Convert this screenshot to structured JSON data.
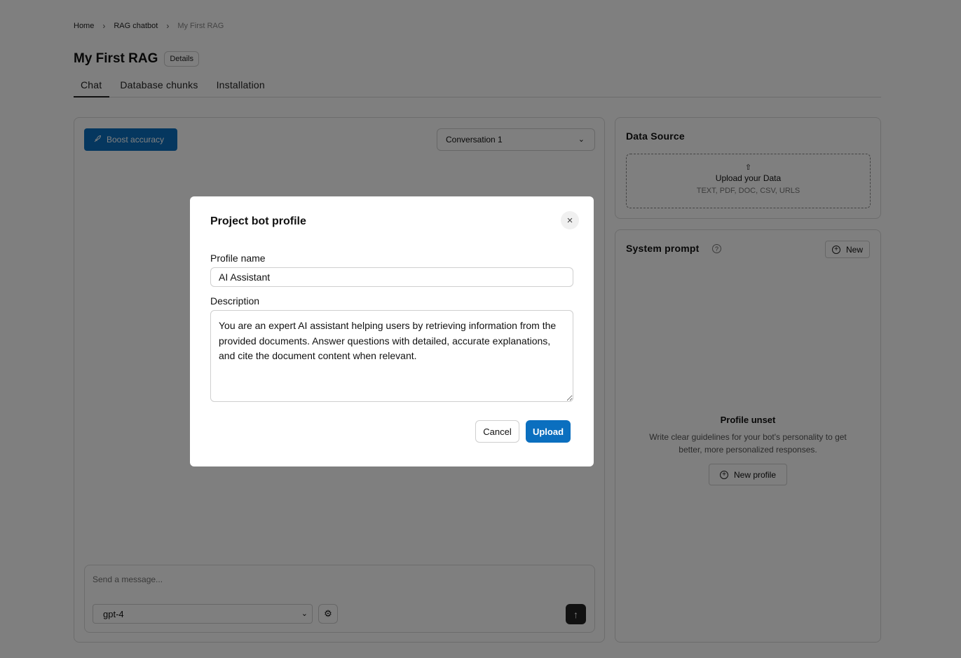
{
  "breadcrumb": {
    "home": "Home",
    "rag_chatbot": "RAG chatbot",
    "current": "My First RAG"
  },
  "header": {
    "title": "My First RAG",
    "details_label": "Details"
  },
  "tabs": [
    {
      "label": "Chat",
      "active": true
    },
    {
      "label": "Database chunks",
      "active": false
    },
    {
      "label": "Installation",
      "active": false
    }
  ],
  "chat": {
    "boost_label": "Boost accuracy",
    "conversation_label": "Conversation 1",
    "message_placeholder": "Send a message...",
    "model_value": "gpt-4"
  },
  "data_source": {
    "title": "Data Source",
    "upload_title": "Upload your Data",
    "upload_types": "TEXT, PDF, DOC, CSV, URLS"
  },
  "system_prompt": {
    "title": "System prompt",
    "new_label": "New",
    "unset_title": "Profile unset",
    "unset_desc": "Write clear guidelines for your bot's personality to get better, more personalized responses.",
    "new_profile_label": "New profile"
  },
  "modal": {
    "title": "Project bot profile",
    "profile_name_label": "Profile name",
    "profile_name_value": "AI Assistant",
    "description_label": "Description",
    "description_value": "You are an expert AI assistant helping users by retrieving information from the provided documents. Answer questions with detailed, accurate explanations, and cite the document content when relevant.",
    "cancel_label": "Cancel",
    "upload_label": "Upload"
  },
  "colors": {
    "accent": "#0b6fbf",
    "overlay": "rgba(0,0,0,0.5)"
  }
}
